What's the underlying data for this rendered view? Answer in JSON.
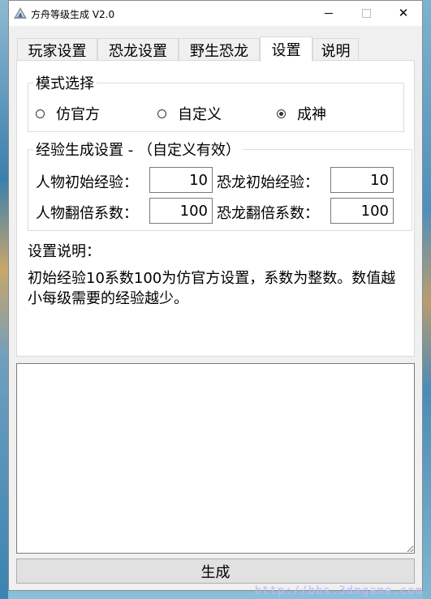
{
  "window": {
    "title": "方舟等级生成 V2.0",
    "controls": {
      "minimize": "minimize",
      "maximize": "maximize",
      "close": "✕"
    }
  },
  "tabs": [
    {
      "label": "玩家设置",
      "active": false
    },
    {
      "label": "恐龙设置",
      "active": false
    },
    {
      "label": "野生恐龙",
      "active": false
    },
    {
      "label": "设置",
      "active": true
    },
    {
      "label": "说明",
      "active": false
    }
  ],
  "mode_group": {
    "legend": "模式选择",
    "options": [
      {
        "label": "仿官方",
        "checked": false
      },
      {
        "label": "自定义",
        "checked": false
      },
      {
        "label": "成神",
        "checked": true
      }
    ]
  },
  "exp_group": {
    "legend": "经验生成设置 - （自定义有效）",
    "player_init_label": "人物初始经验：",
    "player_init_value": "10",
    "dino_init_label": "恐龙初始经验：",
    "dino_init_value": "10",
    "player_mult_label": "人物翻倍系数：",
    "player_mult_value": "100",
    "dino_mult_label": "恐龙翻倍系数：",
    "dino_mult_value": "100"
  },
  "description": {
    "title": "设置说明：",
    "text": "初始经验10系数100为仿官方设置，系数为整数。数值越小每级需要的经验越少。"
  },
  "output": {
    "value": ""
  },
  "generate_button": "生成",
  "watermark": "http://bbs.3dmgame.com",
  "colors": {
    "window_bg": "#f0f0f0",
    "panel_bg": "#ffffff",
    "button_bg": "#e1e1e1"
  }
}
